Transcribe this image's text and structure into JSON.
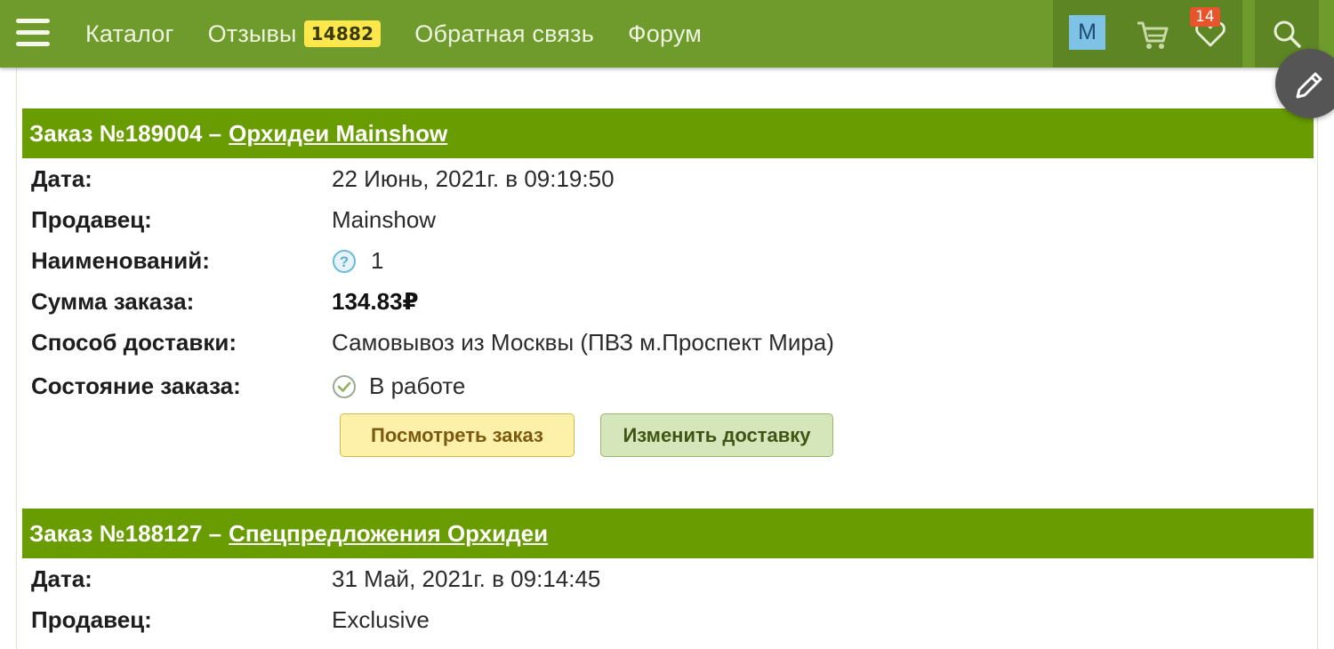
{
  "nav": {
    "catalog": "Каталог",
    "reviews": "Отзывы",
    "reviews_count": "14882",
    "feedback": "Обратная связь",
    "forum": "Форум"
  },
  "user": {
    "avatar_letter": "M",
    "favorites_count": "14"
  },
  "icons": {
    "menu": "hamburger-icon",
    "cart": "cart-icon",
    "favorites": "heart-icon",
    "search": "search-icon",
    "edit": "pencil-icon",
    "help": "question-icon",
    "status": "check-circle-icon"
  },
  "colors": {
    "header": "#6f9a2c",
    "order_header": "#689c00",
    "badge": "#fce84d",
    "fav_badge": "#e8542c"
  },
  "orders": [
    {
      "title": "Заказ №189004 –",
      "shop": "Орхидеи Mainshow",
      "date_label": "Дата:",
      "date": "22 Июнь, 2021г. в 09:19:50",
      "seller_label": "Продавец:",
      "seller": "Mainshow",
      "items_label": "Наименований:",
      "items": "1",
      "sum_label": "Сумма заказа:",
      "sum": "134.83₽",
      "delivery_label": "Способ доставки:",
      "delivery": "Самовывоз из Москвы (ПВЗ м.Проспект Мира)",
      "status_label": "Состояние заказа:",
      "status": "В работе",
      "view_button": "Посмотреть заказ",
      "change_button": "Изменить доставку"
    },
    {
      "title": "Заказ №188127 –",
      "shop": "Спецпредложения Орхидеи",
      "date_label": "Дата:",
      "date": "31 Май, 2021г. в 09:14:45",
      "seller_label": "Продавец:",
      "seller": "Exclusive"
    }
  ]
}
